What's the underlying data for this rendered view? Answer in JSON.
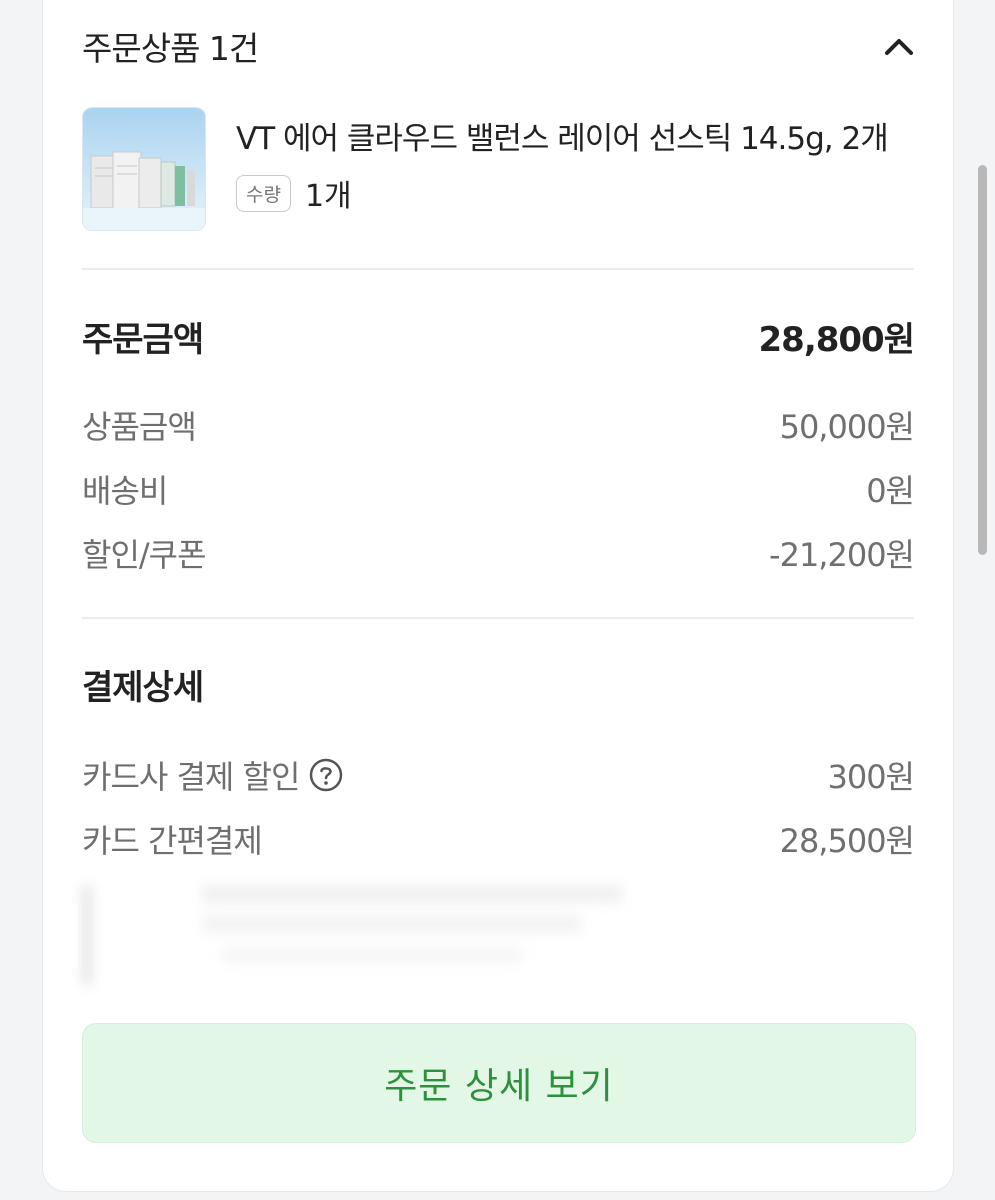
{
  "order_items": {
    "header_title": "주문상품 1건",
    "product": {
      "name": "VT 에어 클라우드 밸런스 레이어 선스틱 14.5g, 2개",
      "quantity_label": "수량",
      "quantity_value": "1개"
    }
  },
  "order_amount": {
    "title": "주문금액",
    "total": "28,800원",
    "rows": [
      {
        "label": "상품금액",
        "value": "50,000원"
      },
      {
        "label": "배송비",
        "value": "0원"
      },
      {
        "label": "할인/쿠폰",
        "value": "-21,200원"
      }
    ]
  },
  "payment_detail": {
    "title": "결제상세",
    "rows": [
      {
        "label": "카드사 결제 할인",
        "value": "300원"
      },
      {
        "label": "카드 간편결제",
        "value": "28,500원"
      }
    ]
  },
  "actions": {
    "detail_button": "주문 상세 보기"
  },
  "colors": {
    "accent_green": "#2f8f3e",
    "button_bg": "#e3f7e6"
  },
  "icons": {
    "collapse": "chevron-up-icon",
    "help": "question-circle-icon"
  }
}
